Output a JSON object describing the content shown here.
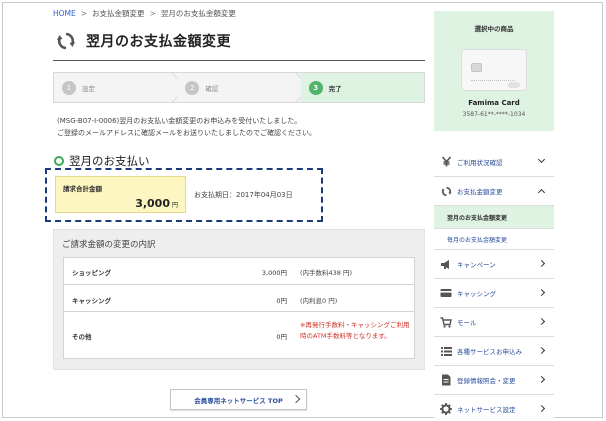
{
  "breadcrumb": {
    "items": [
      "HOME",
      "お支払金額変更",
      "翌月のお支払金額変更"
    ],
    "separator": ">"
  },
  "page": {
    "title": "翌月のお支払金額変更",
    "title_icon": "refresh-icon"
  },
  "steps": [
    {
      "num": "1",
      "label": "設定",
      "active": false
    },
    {
      "num": "2",
      "label": "確認",
      "active": false
    },
    {
      "num": "3",
      "label": "完了",
      "active": true
    }
  ],
  "message": {
    "line1": "(MSG-B07-I-0006)翌月のお支払い金額変更のお申込みを受付いたしました。",
    "line2": "ご登録のメールアドレスに確認メールをお送りいたしましたのでご確認ください。"
  },
  "payment_section": {
    "heading": "翌月のお支払い",
    "total_label": "請求合計金額",
    "total_amount": "3,000",
    "total_unit": "円",
    "due_date": "お支払期日：2017年04月03日"
  },
  "breakdown": {
    "title": "ご請求金額の変更の内訳",
    "rows": [
      {
        "label": "ショッピング",
        "value": "3,000円",
        "note": "(内手数料438 円)",
        "note_red": false
      },
      {
        "label": "キャッシング",
        "value": "0円",
        "note": "(内利息0 円)",
        "note_red": false
      },
      {
        "label": "その他",
        "value": "0円",
        "note": "※再発行手数料・キャッシングご利用時のATM手数料等となります。",
        "note_red": true
      }
    ]
  },
  "cta": {
    "label": "会員専用ネットサービス TOP"
  },
  "card_panel": {
    "heading": "選択中の商品",
    "card_name": "Famima Card",
    "card_number": "3587-61**-****-1034"
  },
  "nav": {
    "items": [
      {
        "label": "ご利用状況確認",
        "icon": "yen-icon",
        "chevron": "down"
      },
      {
        "label": "お支払金額変更",
        "icon": "refresh-icon",
        "chevron": "up"
      },
      {
        "label": "キャンペーン",
        "icon": "megaphone-icon",
        "chevron": "right"
      },
      {
        "label": "キャッシング",
        "icon": "card-icon",
        "chevron": "right"
      },
      {
        "label": "モール",
        "icon": "cart-icon",
        "chevron": "right"
      },
      {
        "label": "各種サービスお申込み",
        "icon": "list-icon",
        "chevron": "right"
      },
      {
        "label": "登録情報照会・変更",
        "icon": "document-icon",
        "chevron": "right"
      },
      {
        "label": "ネットサービス設定",
        "icon": "gear-icon",
        "chevron": "right"
      }
    ],
    "sub_items": [
      {
        "label": "翌月のお支払金額変更",
        "active": true
      },
      {
        "label": "毎月のお支払金額変更",
        "active": false
      }
    ]
  },
  "colors": {
    "accent_green": "#52b36a",
    "panel_green": "#dff3e3",
    "link_blue": "#2a4d9b",
    "highlight_yellow": "#fcf6c0",
    "dash_navy": "#1a3b7a",
    "note_red": "#d2332c"
  }
}
